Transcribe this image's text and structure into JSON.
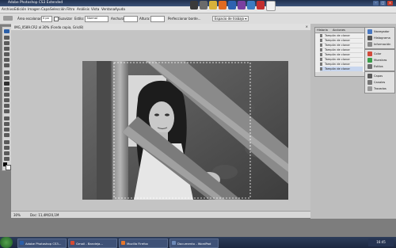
{
  "window": {
    "title": "Adobe Photoshop CS3 Extended",
    "controls": [
      "–",
      "□",
      "×"
    ]
  },
  "menubar": {
    "items": [
      "Archivo",
      "Edición",
      "Imagen",
      "Capa",
      "Selección",
      "Filtro",
      "Análisis",
      "Vista",
      "Ventana",
      "Ayuda"
    ]
  },
  "options": {
    "feather_label": "Área escalonado:",
    "feather_value": "0 px",
    "antialias_label": "Suavizar",
    "style_label": "Estilo:",
    "style_value": "Normal",
    "width_label": "Anchura:",
    "height_label": "Altura:",
    "refine_label": "Perfeccionar borde...",
    "workspace_label": "Espacio de trabajo ▾"
  },
  "document": {
    "tab_title": "IMG_0589.CR2 al 30% (Fondo copia, Gris/8)"
  },
  "status": {
    "zoom": "30%",
    "doc_info": "Doc: 11,4M/20,1M"
  },
  "history_panel": {
    "tabs": [
      "Historia",
      "Acciones"
    ],
    "rows": [
      "Tampón de clonar",
      "Tampón de clonar",
      "Tampón de clonar",
      "Tampón de clonar",
      "Tampón de clonar",
      "Tampón de clonar",
      "Tampón de clonar",
      "Tampón de clonar"
    ]
  },
  "dock1": {
    "items": [
      "Navegador",
      "Histograma",
      "Información"
    ]
  },
  "dock2": {
    "items": [
      "Color",
      "Muestras",
      "Estilos"
    ]
  },
  "dock3": {
    "items": [
      "Capas",
      "Canales",
      "Trazados"
    ]
  },
  "taskbar": {
    "tasks": [
      {
        "label": "Adobe Photoshop CS3...",
        "color": "#2b5fa8"
      },
      {
        "label": "Gmail - Bandeja...",
        "color": "#d64a32"
      },
      {
        "label": "Mozilla Firefox",
        "color": "#e5762b"
      },
      {
        "label": "Documento - WordPad",
        "color": "#6c89b7"
      }
    ],
    "clock": "16:45"
  },
  "colors": {
    "accent": "#2b5fa8",
    "canvas_bg": "#c4c4c4",
    "panel_bg": "#e1e1e1"
  }
}
